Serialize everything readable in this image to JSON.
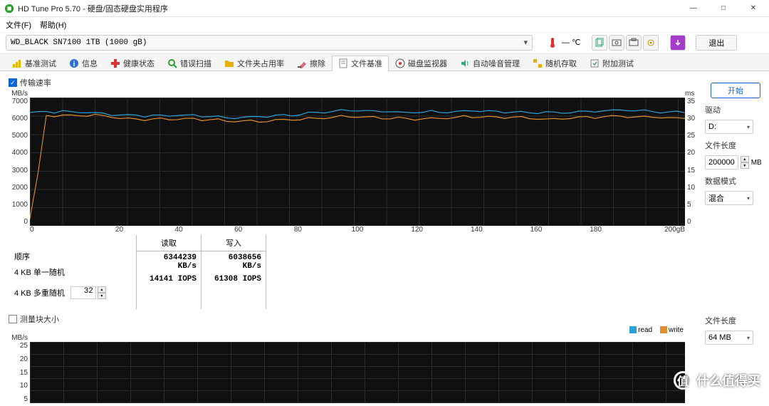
{
  "window": {
    "title": "HD Tune Pro 5.70 - 硬盘/固态硬盘实用程序",
    "min_icon": "—",
    "max_icon": "□",
    "close_icon": "✕"
  },
  "menu": {
    "file": "文件(F)",
    "help": "帮助(H)"
  },
  "toolbar": {
    "device": "WD_BLACK SN7100 1TB (1000 gB)",
    "temp": "— ℃",
    "exit": "退出"
  },
  "tabs": [
    {
      "label": "基准测试",
      "icon": "benchmark"
    },
    {
      "label": "信息",
      "icon": "info"
    },
    {
      "label": "健康状态",
      "icon": "health"
    },
    {
      "label": "错误扫描",
      "icon": "scan"
    },
    {
      "label": "文件夹占用率",
      "icon": "folder"
    },
    {
      "label": "擦除",
      "icon": "erase"
    },
    {
      "label": "文件基准",
      "icon": "filebench",
      "active": true
    },
    {
      "label": "磁盘监视器",
      "icon": "monitor"
    },
    {
      "label": "自动噪音管理",
      "icon": "aam"
    },
    {
      "label": "随机存取",
      "icon": "random"
    },
    {
      "label": "附加测试",
      "icon": "extra"
    }
  ],
  "controls": {
    "start": "开始",
    "drive_label": "驱动",
    "drive_value": "D:",
    "filelen_label": "文件长度",
    "filelen_value": "200000",
    "filelen_unit": "MB",
    "datamode_label": "数据模式",
    "datamode_value": "混合",
    "size_label": "文件长度",
    "size_value": "64 MB"
  },
  "section1": {
    "check": "传输速率",
    "yunit_left": "MB/s",
    "yunit_right": "ms",
    "xunit_last": "200gB"
  },
  "stats": {
    "rows": [
      "顺序",
      "4 KB 单一随机",
      "4 KB 多重随机"
    ],
    "cols": [
      "读取",
      "写入"
    ],
    "seq_read": "6344239 KB/s",
    "seq_write": "6038656 KB/s",
    "r4k_read": "14141 IOPS",
    "r4k_write": "61308 IOPS",
    "queue_depth": "32"
  },
  "section2": {
    "check": "测量块大小",
    "yunit": "MB/s",
    "legend_read": "read",
    "legend_write": "write"
  },
  "watermark": {
    "char": "值",
    "text": "什么值得买"
  },
  "chart_data": {
    "type": "line",
    "x": [
      0,
      20,
      40,
      60,
      80,
      100,
      120,
      140,
      160,
      180,
      200
    ],
    "yticks_left": [
      0,
      1000,
      2000,
      3000,
      4000,
      5000,
      6000,
      7000
    ],
    "yticks_right": [
      0,
      5,
      10,
      15,
      20,
      25,
      30,
      35
    ],
    "series": [
      {
        "name": "read",
        "color": "#2da0d8",
        "values_y": [
          6200,
          6150,
          6050,
          5900,
          6100,
          6250,
          6250,
          6200,
          6250,
          6250,
          6250
        ]
      },
      {
        "name": "write",
        "color": "#e08f2e",
        "values_y": [
          5950,
          6000,
          5850,
          5700,
          5850,
          5900,
          5900,
          5900,
          5900,
          5900,
          5950
        ]
      }
    ],
    "xlabel": "gB",
    "ylabel_left": "MB/s",
    "ylabel_right": "ms",
    "ylim_left": [
      0,
      7000
    ],
    "ylim_right": [
      0,
      35
    ]
  },
  "chart2_yticks": [
    5,
    10,
    15,
    20,
    25
  ]
}
